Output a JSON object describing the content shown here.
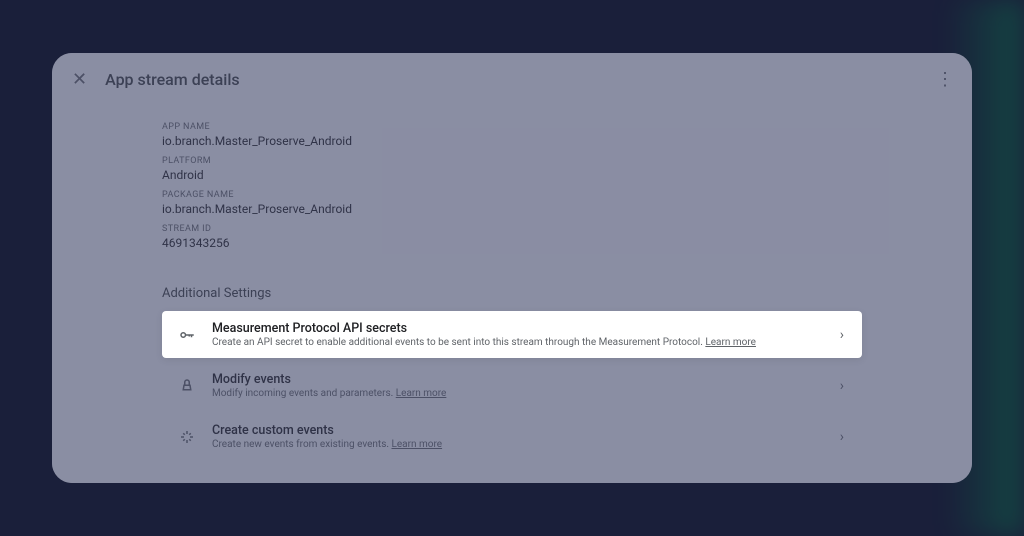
{
  "header": {
    "title": "App stream details"
  },
  "details": {
    "appNameLabel": "APP NAME",
    "appNameValue": "io.branch.Master_Proserve_Android",
    "platformLabel": "PLATFORM",
    "platformValue": "Android",
    "packageNameLabel": "PACKAGE NAME",
    "packageNameValue": "io.branch.Master_Proserve_Android",
    "streamIdLabel": "STREAM ID",
    "streamIdValue": "4691343256"
  },
  "additional": {
    "sectionTitle": "Additional Settings",
    "learnMore": "Learn more",
    "rows": [
      {
        "title": "Measurement Protocol API secrets",
        "subtitle": "Create an API secret to enable additional events to be sent into this stream through the Measurement Protocol. "
      },
      {
        "title": "Modify events",
        "subtitle": "Modify incoming events and parameters. "
      },
      {
        "title": "Create custom events",
        "subtitle": "Create new events from existing events. "
      }
    ]
  }
}
